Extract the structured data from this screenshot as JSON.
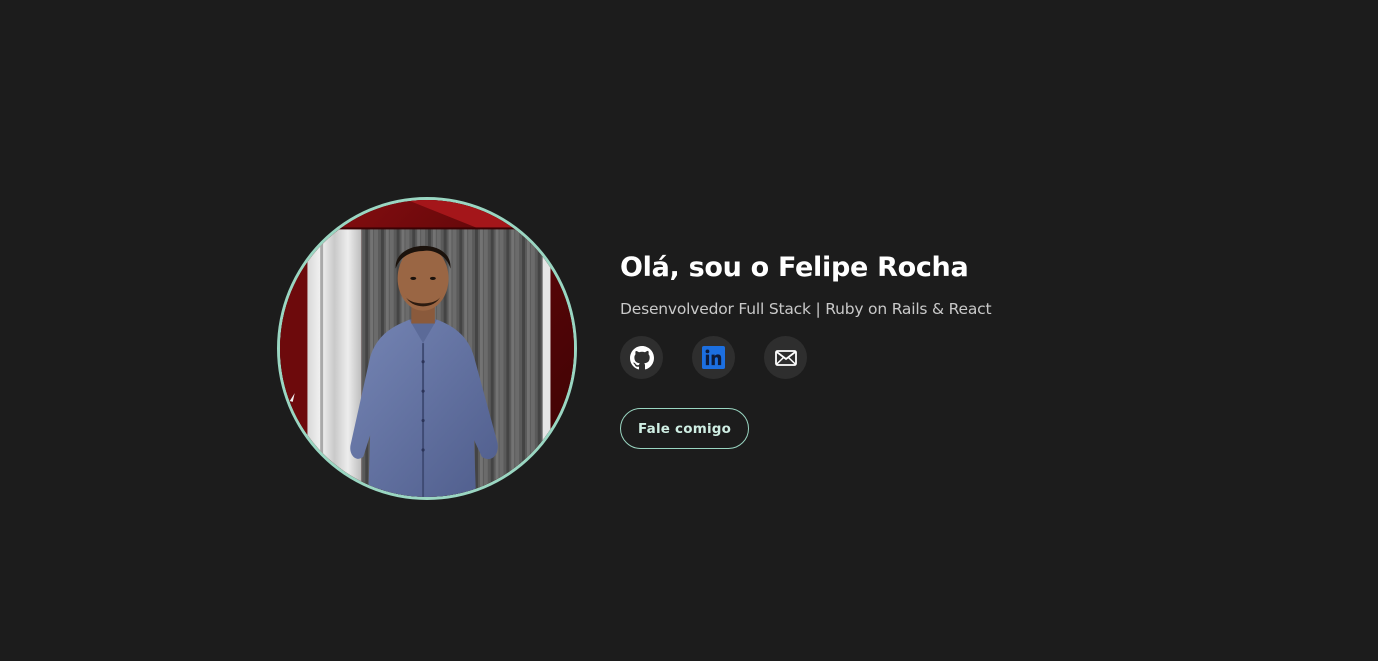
{
  "profile": {
    "greeting": "Olá, sou o Felipe Rocha",
    "role": "Desenvolvedor Full Stack | Ruby on Rails & React"
  },
  "social_links": [
    {
      "icon": "github-icon"
    },
    {
      "icon": "linkedin-icon",
      "color": "#1c6fe0"
    },
    {
      "icon": "mail-icon"
    }
  ],
  "cta": {
    "label": "Fale comigo"
  },
  "colors": {
    "background": "#1c1c1c",
    "accent": "#9ad6c2",
    "icon_bg": "#2e2e2e",
    "linkedin": "#1c6fe0"
  }
}
